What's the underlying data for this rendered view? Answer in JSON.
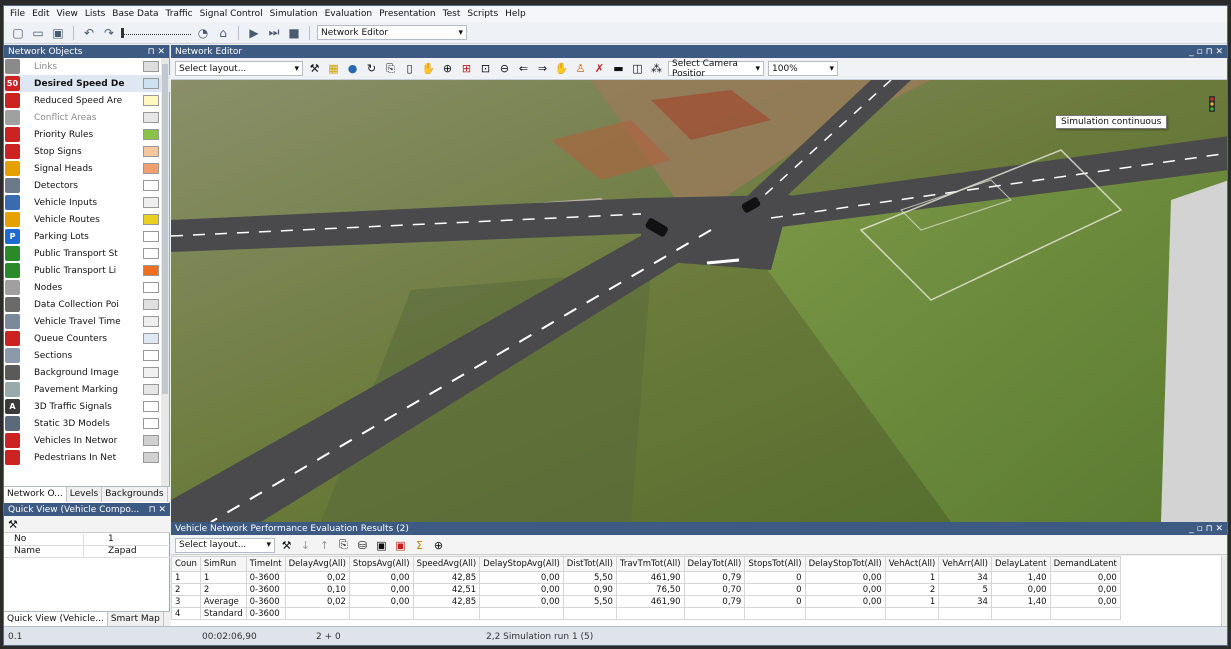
{
  "menu": [
    "File",
    "Edit",
    "View",
    "Lists",
    "Base Data",
    "Traffic",
    "Signal Control",
    "Simulation",
    "Evaluation",
    "Presentation",
    "Test",
    "Scripts",
    "Help"
  ],
  "toolbar": {
    "editor_combo": "Network Editor"
  },
  "network_objects": {
    "title": "Network Objects",
    "items": [
      {
        "label": "Links",
        "gray": true,
        "icon_color": "#8a8a8a",
        "swatch": "#dddddd"
      },
      {
        "label": "Desired Speed De",
        "selected": true,
        "icon_color": "#cc2222",
        "swatch": "#cfe0f0",
        "glyph": "50"
      },
      {
        "label": "Reduced Speed Are",
        "icon_color": "#cc2222",
        "swatch": "#fff8c0"
      },
      {
        "label": "Conflict Areas",
        "gray": true,
        "icon_color": "#a0a0a0",
        "swatch": "#e6e6e6"
      },
      {
        "label": "Priority Rules",
        "icon_color": "#cc2222",
        "swatch": "#8bc34a"
      },
      {
        "label": "Stop Signs",
        "icon_color": "#cc2222",
        "swatch": "#f5c6a0"
      },
      {
        "label": "Signal Heads",
        "icon_color": "#e6a000",
        "swatch": "#f0a070"
      },
      {
        "label": "Detectors",
        "icon_color": "#6a7a8a",
        "swatch": "#ffffff"
      },
      {
        "label": "Vehicle Inputs",
        "icon_color": "#3a6ab0",
        "swatch": "#eeeeee"
      },
      {
        "label": "Vehicle Routes",
        "icon_color": "#e6a000",
        "swatch": "#e8d020"
      },
      {
        "label": "Parking Lots",
        "icon_color": "#1e6ad0",
        "swatch": "#ffffff",
        "glyph": "P"
      },
      {
        "label": "Public Transport St",
        "icon_color": "#2a8a2a",
        "swatch": "#ffffff"
      },
      {
        "label": "Public Transport Li",
        "icon_color": "#2a8a2a",
        "swatch": "#f07020"
      },
      {
        "label": "Nodes",
        "icon_color": "#a0a0a0",
        "swatch": "#ffffff"
      },
      {
        "label": "Data Collection Poi",
        "icon_color": "#6a6a6a",
        "swatch": "#e0e0e0"
      },
      {
        "label": "Vehicle Travel Time",
        "icon_color": "#7a8a9a",
        "swatch": "#eeeeee"
      },
      {
        "label": "Queue Counters",
        "icon_color": "#cc2222",
        "swatch": "#e0e8f4"
      },
      {
        "label": "Sections",
        "icon_color": "#8a9aaa",
        "swatch": "#ffffff"
      },
      {
        "label": "Background Image",
        "icon_color": "#5a5a5a",
        "swatch": "#f0f0f0"
      },
      {
        "label": "Pavement Marking",
        "icon_color": "#9aa",
        "swatch": "#e6e6e6"
      },
      {
        "label": "3D Traffic Signals",
        "icon_color": "#3a3a3a",
        "swatch": "#ffffff",
        "glyph": "A"
      },
      {
        "label": "Static 3D Models",
        "icon_color": "#5a6a7a",
        "swatch": "#ffffff"
      },
      {
        "label": "Vehicles In Networ",
        "icon_color": "#cc2222",
        "swatch": "#d0d0d0"
      },
      {
        "label": "Pedestrians In Net",
        "icon_color": "#cc2222",
        "swatch": "#d0d0d0"
      }
    ]
  },
  "left_tabs": [
    "Network O...",
    "Levels",
    "Backgrounds"
  ],
  "quick_view": {
    "title": "Quick View (Vehicle Compo...",
    "rows": [
      {
        "key": "No",
        "value": "1"
      },
      {
        "key": "Name",
        "value": "Zapad"
      }
    ],
    "tabs": [
      "Quick View (Vehicle...",
      "Smart Map"
    ]
  },
  "network_editor": {
    "title": "Network Editor",
    "layout_combo": "Select layout...",
    "camera_combo": "Select Camera Positior",
    "zoom_combo": "100%",
    "tooltip": "Simulation continuous"
  },
  "results": {
    "title": "Vehicle Network Performance Evaluation Results (2)",
    "layout_combo": "Select layout...",
    "columns": [
      "Coun",
      "SimRun",
      "TimeInt",
      "DelayAvg(All)",
      "StopsAvg(All)",
      "SpeedAvg(All)",
      "DelayStopAvg(All)",
      "DistTot(All)",
      "TravTmTot(All)",
      "DelayTot(All)",
      "StopsTot(All)",
      "DelayStopTot(All)",
      "VehAct(All)",
      "VehArr(All)",
      "DelayLatent",
      "DemandLatent"
    ],
    "rows": [
      [
        "1",
        "1",
        "0-3600",
        "0,02",
        "0,00",
        "42,85",
        "0,00",
        "5,50",
        "461,90",
        "0,79",
        "0",
        "0,00",
        "1",
        "34",
        "1,40",
        "0,00"
      ],
      [
        "2",
        "2",
        "0-3600",
        "0,10",
        "0,00",
        "42,51",
        "0,00",
        "0,90",
        "76,50",
        "0,70",
        "0",
        "0,00",
        "2",
        "5",
        "0,00",
        "0,00"
      ],
      [
        "3",
        "Average",
        "0-3600",
        "0,02",
        "0,00",
        "42,85",
        "0,00",
        "5,50",
        "461,90",
        "0,79",
        "0",
        "0,00",
        "1",
        "34",
        "1,40",
        "0,00"
      ],
      [
        "4",
        "Standard",
        "0-3600",
        "",
        "",
        "",
        "",
        "",
        "",
        "",
        "",
        "",
        "",
        "",
        "",
        ""
      ]
    ]
  },
  "status": {
    "zoom": "0.1",
    "time": "00:02:06,90",
    "step": "2 + 0",
    "run": "2,2  Simulation run 1 (5)"
  },
  "colors": {
    "title_bar": "#3d5a82",
    "grass": "#6e8a3a",
    "road": "#4a4a4c"
  }
}
